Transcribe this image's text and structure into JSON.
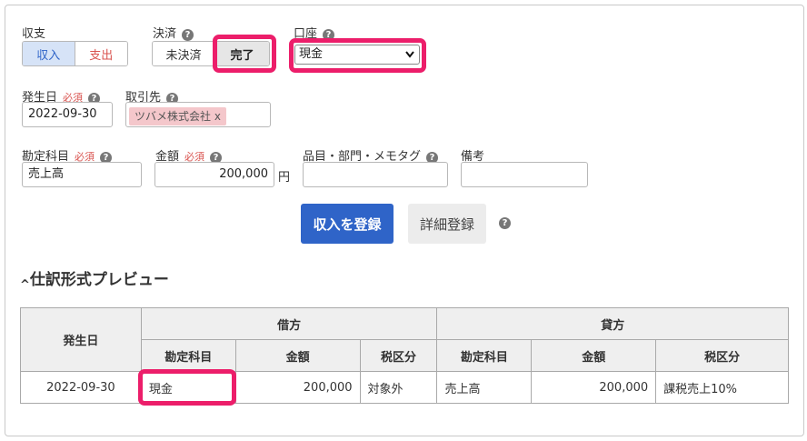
{
  "form": {
    "balance": {
      "label": "収支",
      "options": [
        "収入",
        "支出"
      ],
      "selected": "収入"
    },
    "settlement": {
      "label": "決済",
      "options": [
        "未決済",
        "完了"
      ],
      "selected": "完了"
    },
    "account": {
      "label": "口座",
      "value": "現金"
    },
    "issue_date": {
      "label": "発生日",
      "required": "必須",
      "value": "2022-09-30"
    },
    "partner": {
      "label": "取引先",
      "tag": "ツバメ株式会社 x"
    },
    "account_item": {
      "label": "勘定科目",
      "required": "必須",
      "value": "売上高"
    },
    "amount": {
      "label": "金額",
      "required": "必須",
      "value": "200,000",
      "unit": "円"
    },
    "item_tags": {
      "label": "品目・部門・メモタグ",
      "value": ""
    },
    "remarks": {
      "label": "備考",
      "value": ""
    },
    "help_glyph": "?",
    "register_button": "収入を登録",
    "detail_button": "詳細登録"
  },
  "preview": {
    "toggle_glyph": "^",
    "title": "仕訳形式プレビュー",
    "headers": {
      "date": "発生日",
      "debit": "借方",
      "credit": "貸方",
      "account": "勘定科目",
      "amount": "金額",
      "tax": "税区分"
    },
    "row": {
      "date": "2022-09-30",
      "debit_account": "現金",
      "debit_amount": "200,000",
      "debit_tax": "対象外",
      "credit_account": "売上高",
      "credit_amount": "200,000",
      "credit_tax": "課税売上10%"
    }
  },
  "colors": {
    "highlight": "#ec1e6a",
    "primary": "#2f64c8",
    "income_text": "#2f64c8",
    "expense_text": "#d9534f",
    "tag_bg": "#f4c7cb"
  }
}
